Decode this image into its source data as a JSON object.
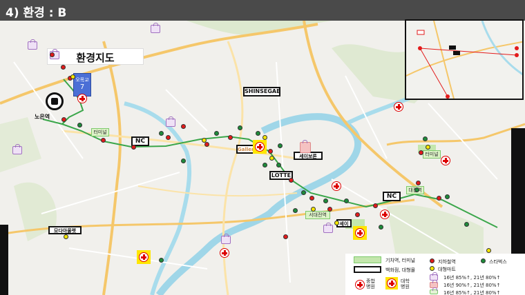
{
  "header": {
    "title": "4) 환경 : B"
  },
  "map": {
    "title": "환경지도",
    "labels": {
      "shinsegae": "SHINSEGAE",
      "nc1": "NC",
      "nc2": "NC",
      "lotte": "LOTTE",
      "sebuko": "세이보론",
      "modano": "모다아울렛",
      "sei": "세이",
      "station_7": "오목교",
      "station_7_num": "7",
      "noeun": "노은역",
      "terminal1": "터미널",
      "terminal2": "터미널",
      "daejeon": "대전역",
      "seodaejeon": "서대전역"
    }
  },
  "legend": {
    "train": "기차역, 터미널",
    "dept": "백화점, 대형몰",
    "general_hospital": "종합\n병원",
    "univ_hospital": "대학\n병원",
    "subway": "지하철역",
    "mart": "대형마트",
    "starbucks": "스타벅스",
    "line1": "16년 85%↑, 21년 80%↑",
    "line2": "16년 90%↑, 21년 80%↑",
    "line3": "16년 85%↑, 21년 80%↑"
  },
  "colors": {
    "header_bg": "#4a4a4a",
    "red": "#e21b1b",
    "green": "#1e8b3a",
    "yellow": "#f4e600",
    "road": "#f5c76a",
    "river": "#9fd6e8"
  }
}
